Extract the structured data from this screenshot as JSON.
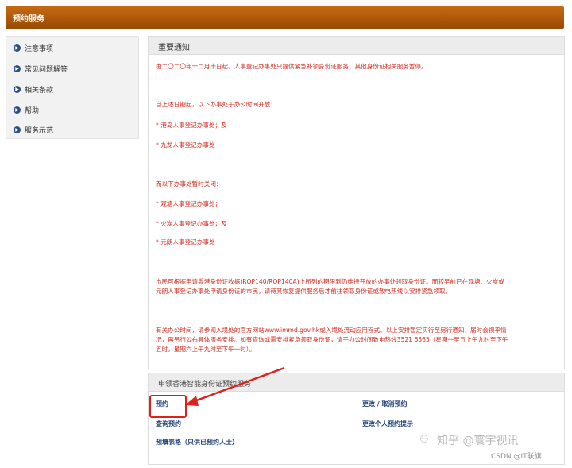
{
  "header": {
    "title": "预约服务"
  },
  "sidebar": {
    "items": [
      {
        "label": "注意事项",
        "icon": "arrow-right-circle-icon"
      },
      {
        "label": "常见问题解答",
        "icon": "arrow-right-circle-icon"
      },
      {
        "label": "相关条款",
        "icon": "arrow-right-circle-icon"
      },
      {
        "label": "帮助",
        "icon": "arrow-right-circle-icon"
      },
      {
        "label": "服务示范",
        "icon": "arrow-right-circle-icon"
      }
    ]
  },
  "notice": {
    "title": "重要通知",
    "lines": [
      "由二〇二〇年十二月十日起，人事登记办事处只提供紧急补领身份证服务，其他身份证相关服务暂停。",
      "自上述日期起，以下办事处于办公时间开放：",
      "* 港岛人事登记办事处；及",
      "* 九龙人事登记办事处",
      "而以下办事处暂时关闭：",
      "* 观塘人事登记办事处；",
      "* 火炭人事登记办事处；及",
      "* 元朗人事登记办事处",
      "市民可根据申请香港身份证收据(ROP140/ROP140A)上所列的期限到仍维持开放的办事处领取身份证。而较早前已在观塘、火炭或",
      "元朗人事登记办事处申请身份证的市民，请待其恢复提供服务后才前往领取身份证或致电热线以安排紧急领取。",
      "有关办公时间，请参阅入境处的官方网站www.immd.gov.hk或入境处流动应用程式。以上安排暂定实行至另行通知，届时会视乎情",
      "况，再另行公布具体服务安排。如有查询或需安排紧急领取身份证，请于办公时间致电热线3521 6565（星期一至五上午九时至下午",
      "五时，星期六上午九时至下午一时）。"
    ]
  },
  "service": {
    "title": "申领香港智能身份证预约服务",
    "links": {
      "book": "预约",
      "change_cancel": "更改 / 取消预约",
      "enquiry": "查询预约",
      "change_reminder": "更改个人预约提示",
      "prefill": "预填表格（只供已预约人士）"
    }
  },
  "watermark": {
    "text": "知乎 @寰宇视讯",
    "csdn": "CSDN @IT联旗"
  },
  "colors": {
    "header": "#b35a0c",
    "notice_text": "#d42a1c",
    "link": "#1f3f78",
    "highlight": "#e0201b"
  }
}
